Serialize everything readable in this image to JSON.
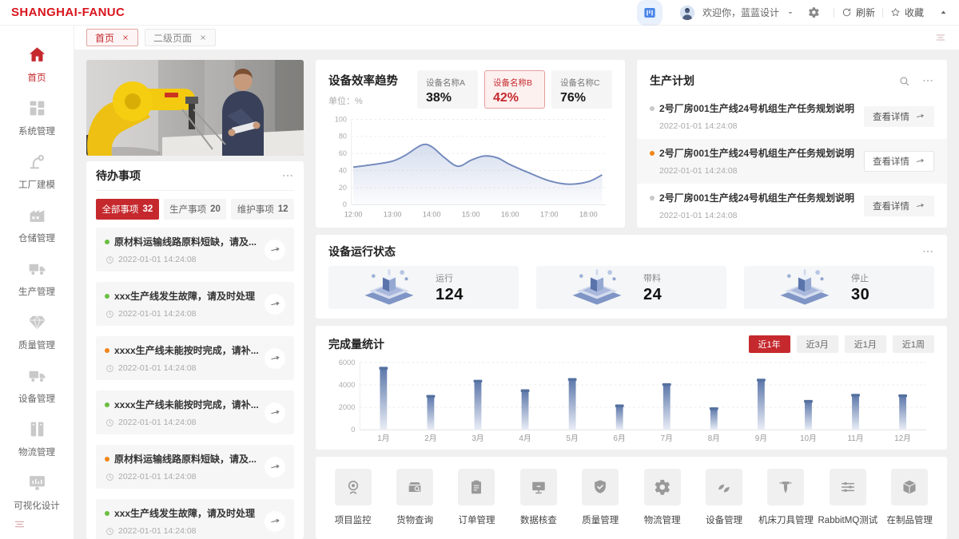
{
  "header": {
    "logo": "SHANGHAI-FANUC",
    "welcome": "欢迎你，蓝蓝设计",
    "refresh": "刷新",
    "favorite": "收藏"
  },
  "tabs": [
    {
      "label": "首页",
      "active": true
    },
    {
      "label": "二级页面",
      "active": false
    }
  ],
  "sidebar": {
    "items": [
      {
        "label": "首页",
        "icon": "home-icon",
        "active": true
      },
      {
        "label": "系统管理",
        "icon": "modules-grid-icon",
        "active": false
      },
      {
        "label": "工厂建模",
        "icon": "robot-arm-icon",
        "active": false
      },
      {
        "label": "仓储管理",
        "icon": "warehouse-icon",
        "active": false
      },
      {
        "label": "生产管理",
        "icon": "truck-icon",
        "active": false
      },
      {
        "label": "质量管理",
        "icon": "diamond-icon",
        "active": false
      },
      {
        "label": "设备管理",
        "icon": "delivery-truck-icon",
        "active": false
      },
      {
        "label": "物流管理",
        "icon": "cabinet-icon",
        "active": false
      },
      {
        "label": "可视化设计",
        "icon": "monitor-chart-icon",
        "active": false
      }
    ]
  },
  "todo": {
    "title": "待办事项",
    "tabs": [
      {
        "label": "全部事项",
        "count": "32",
        "active": true
      },
      {
        "label": "生产事项",
        "count": "20",
        "active": false
      },
      {
        "label": "维护事项",
        "count": "12",
        "active": false
      }
    ],
    "items": [
      {
        "dot": "green",
        "text": "原材料运输线路原料短缺，请及...",
        "time": "2022-01-01  14:24:08"
      },
      {
        "dot": "green",
        "text": "xxx生产线发生故障，请及时处理",
        "time": "2022-01-01  14:24:08"
      },
      {
        "dot": "orange",
        "text": "xxxx生产线未能按时完成，请补...",
        "time": "2022-01-01  14:24:08"
      },
      {
        "dot": "green",
        "text": "xxxx生产线未能按时完成，请补...",
        "time": "2022-01-01  14:24:08"
      },
      {
        "dot": "orange",
        "text": "原材料运输线路原料短缺，请及...",
        "time": "2022-01-01  14:24:08"
      },
      {
        "dot": "green",
        "text": "xxx生产线发生故障，请及时处理",
        "time": "2022-01-01  14:24:08"
      }
    ]
  },
  "efficiency": {
    "title": "设备效率趋势",
    "unit": "单位：%",
    "devices": [
      {
        "name": "设备名称A",
        "value": "38%",
        "active": false
      },
      {
        "name": "设备名称B",
        "value": "42%",
        "active": true
      },
      {
        "name": "设备名称C",
        "value": "76%",
        "active": false
      }
    ]
  },
  "plan": {
    "title": "生产计划",
    "items": [
      {
        "dot": "gray",
        "text": "2号厂房001生产线24号机组生产任务规划说明",
        "time": "2022-01-01  14:24:08",
        "button": "查看详情",
        "highlighted": false
      },
      {
        "dot": "orange",
        "text": "2号厂房001生产线24号机组生产任务规划说明",
        "time": "2022-01-01  14:24:08",
        "button": "查看详情",
        "highlighted": true
      },
      {
        "dot": "gray",
        "text": "2号厂房001生产线24号机组生产任务规划说明",
        "time": "2022-01-01  14:24:08",
        "button": "查看详情",
        "highlighted": false
      }
    ]
  },
  "status": {
    "title": "设备运行状态",
    "cards": [
      {
        "label": "运行",
        "value": "124"
      },
      {
        "label": "带料",
        "value": "24"
      },
      {
        "label": "停止",
        "value": "30"
      }
    ]
  },
  "completion": {
    "title": "完成量统计",
    "filters": [
      {
        "label": "近1年",
        "active": true
      },
      {
        "label": "近3月",
        "active": false
      },
      {
        "label": "近1月",
        "active": false
      },
      {
        "label": "近1周",
        "active": false
      }
    ]
  },
  "apps": {
    "items": [
      {
        "label": "项目监控",
        "icon": "camera-icon"
      },
      {
        "label": "货物查询",
        "icon": "goods-search-icon"
      },
      {
        "label": "订单管理",
        "icon": "clipboard-icon"
      },
      {
        "label": "数据核查",
        "icon": "monitor-icon"
      },
      {
        "label": "质量管理",
        "icon": "shield-check-icon"
      },
      {
        "label": "物流管理",
        "icon": "gear-icon"
      },
      {
        "label": "设备管理",
        "icon": "leaves-icon"
      },
      {
        "label": "机床刀具管理",
        "icon": "tool-icon"
      },
      {
        "label": "RabbitMQ测试",
        "icon": "sliders-icon"
      },
      {
        "label": "在制品管理",
        "icon": "package-icon"
      }
    ]
  },
  "chart_data": [
    {
      "type": "line",
      "title": "设备效率趋势",
      "ylabel": "%",
      "x": [
        12,
        12.5,
        13,
        13.33,
        13.75,
        14,
        14.33,
        14.67,
        15,
        15.33,
        15.67,
        16,
        16.5,
        17,
        17.5,
        18,
        18.35
      ],
      "y": [
        44,
        47,
        51,
        58,
        70,
        68,
        55,
        45,
        52,
        57,
        55,
        47,
        37,
        28,
        24,
        27,
        35
      ],
      "xlim": [
        11.95,
        18.45
      ],
      "ylim": [
        0,
        100
      ],
      "yticks": [
        0,
        20,
        40,
        60,
        80,
        100
      ],
      "xticks": [
        12,
        13,
        14,
        15,
        16,
        17,
        18
      ],
      "xtick_labels": [
        "12:00",
        "13:00",
        "14:00",
        "15:00",
        "16:00",
        "17:00",
        "18:00"
      ],
      "grid": "dashed-horizontal",
      "line_color": "#7188bb"
    },
    {
      "type": "bar",
      "title": "完成量统计",
      "categories": [
        "1月",
        "2月",
        "3月",
        "4月",
        "5月",
        "6月",
        "7月",
        "8月",
        "9月",
        "10月",
        "11月",
        "12月"
      ],
      "values": [
        5500,
        3000,
        4350,
        3500,
        4500,
        2150,
        4050,
        1900,
        4450,
        2550,
        3100,
        3050
      ],
      "ylim": [
        0,
        6000
      ],
      "yticks": [
        0,
        2000,
        4000,
        6000
      ],
      "grid": "dashed-horizontal",
      "bar_cap_color": "#54719f"
    }
  ]
}
